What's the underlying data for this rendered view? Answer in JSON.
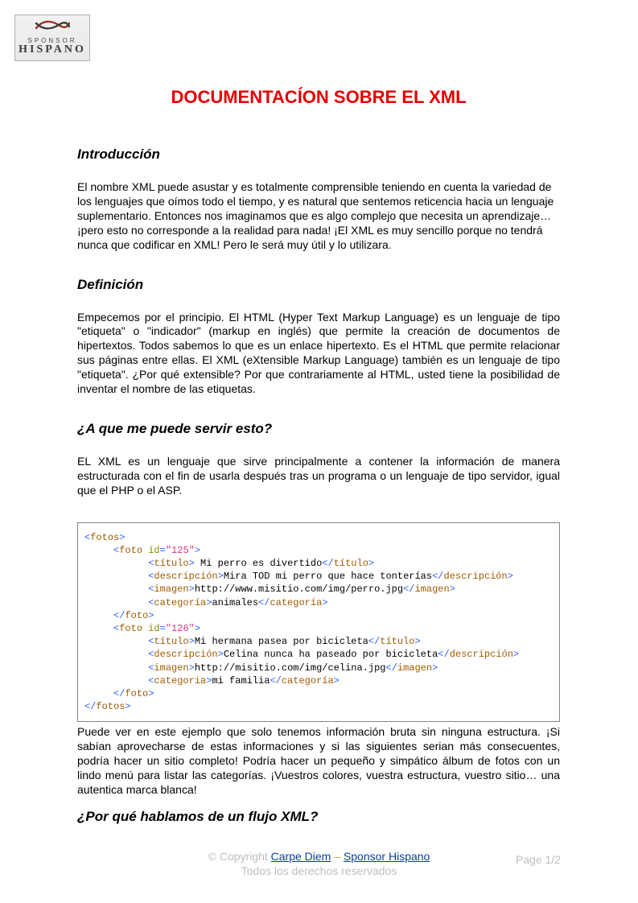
{
  "logo": {
    "line1": "SPONSOR",
    "line2": "HISPANO"
  },
  "title": "DOCUMENTACÍON SOBRE EL XML",
  "sections": {
    "intro": {
      "heading": "Introducción",
      "body": "El nombre XML puede asustar y es totalmente comprensible teniendo en cuenta la variedad de los lenguajes que oímos todo el tiempo, y es natural que sentemos reticencia hacia un lenguaje suplementario. Entonces nos imaginamos que es algo complejo que necesita un aprendizaje… ¡pero esto no corresponde a la realidad para nada! ¡El XML es muy sencillo porque no tendrá nunca que codificar en XML! Pero le será muy útil y lo utilizara"
    },
    "definicion": {
      "heading": "Definición",
      "body": "Empecemos por el principio. El HTML (Hyper Text Markup Language) es un lenguaje de tipo \"etiqueta\" o \"indicador\" (markup en inglés) que permite la creación de documentos de hipertextos. Todos sabemos lo que es un enlace hipertexto. Es el HTML que permite relacionar sus páginas entre ellas. El XML (eXtensible Markup Language) también es un lenguaje de tipo \"etiqueta\". ¿Por qué extensible? Por que contrariamente al HTML, usted tiene la posibilidad de inventar el nombre de las etiquetas."
    },
    "servir": {
      "heading": "¿A que me puede servir esto?",
      "body": "EL XML es un lenguaje que sirve principalmente a contener la información de manera estructurada con el fin de usarla después tras un programa o un lenguaje de tipo servidor, igual que el PHP o el ASP."
    },
    "afterCode": "Puede ver en este ejemplo que solo tenemos información bruta sin ninguna estructura. ¡Si sabían aprovecharse de estas informaciones y si las siguientes serian más consecuentes, podría hacer un sitio completo! Podría hacer un pequeño y simpático álbum de fotos con un lindo menú para listar las categorías. ¡Vuestros colores, vuestra estructura, vuestro sitio… una autentica marca blanca!",
    "flujo": {
      "heading": "¿Por qué hablamos de un flujo XML?"
    }
  },
  "code": {
    "tags": {
      "fotos": "fotos",
      "foto": "foto",
      "titulo": "título",
      "desc": "descripción",
      "imagen": "imagen",
      "categoria": "categoría",
      "categoria2": "categoria"
    },
    "attr_id": "id",
    "entries": [
      {
        "id": "\"125\"",
        "titulo": " Mi perro es divertido",
        "desc": "Mira TOD mi perro que hace tonterías",
        "imagen": "http://www.misitio.com/img/perro.jpg",
        "categoria": "animales"
      },
      {
        "id": "\"126\"",
        "titulo": "Mi hermana pasea por bicicleta",
        "desc": "Celina nunca ha paseado por bicicleta",
        "imagen": "http://misitio.com/img/celina.jpg",
        "categoria": "mi familia"
      }
    ]
  },
  "footer": {
    "copyright": "© Copyright ",
    "link1": "Carpe Diem",
    "sep": " – ",
    "link2": "Sponsor Hispano",
    "rights": "Todos los derechos reservados",
    "page": "Page 1/2"
  },
  "punct": {
    "lt": "<",
    "gt": ">",
    "slash": "/",
    "eq": "=",
    "period": "."
  }
}
